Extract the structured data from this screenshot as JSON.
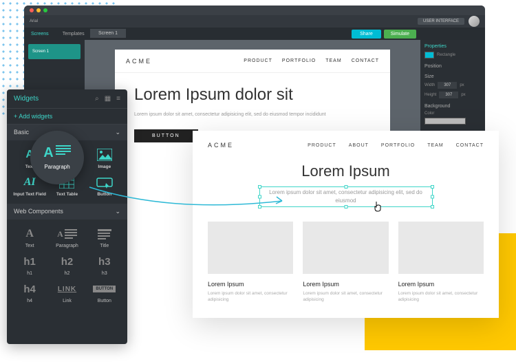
{
  "toolbar": {
    "arial": "Arial",
    "user_menu": "USER INTERFACE"
  },
  "subbar": {
    "screens": "Screens",
    "templates": "Templates",
    "share": "Share",
    "simulate": "Simulate",
    "tab": "Screen 1"
  },
  "screens": {
    "item1": "Screen 1"
  },
  "canvas": {
    "brand": "ACME",
    "nav": [
      "PRODUCT",
      "PORTFOLIO",
      "TEAM",
      "CONTACT"
    ],
    "headline": "Lorem Ipsum dolor sit",
    "body": "Lorem ipsum dolor sit amet, consectetur adipisicing elit, sed do eiusmod tempor incididunt",
    "button": "BUTTON"
  },
  "properties": {
    "title": "Properties",
    "shape": "Rectangle",
    "position": "Position",
    "size": "Size",
    "width": "Width",
    "height": "Height",
    "val_width": "307",
    "val_height": "307",
    "px": "px",
    "background": "Background",
    "color": "Color"
  },
  "widgets": {
    "title": "Widgets",
    "add": "+ Add widgets",
    "basic": "Basic",
    "items_basic": {
      "text": "Text",
      "paragraph": "Paragraph",
      "image": "Image",
      "input": "Input Text Field",
      "table": "Text Table",
      "button": "Button"
    },
    "webcomp": "Web Components",
    "items_wc": {
      "text": "Text",
      "paragraph": "Paragraph",
      "title": "Title",
      "h1": "h1",
      "h2": "h2",
      "h3": "h3",
      "h4": "h4",
      "link": "Link",
      "button": "Button"
    }
  },
  "bubble": {
    "label": "Paragraph"
  },
  "preview": {
    "brand": "ACME",
    "nav": [
      "PRODUCT",
      "ABOUT",
      "PORTFOLIO",
      "TEAM",
      "CONTACT"
    ],
    "title": "Lorem Ipsum",
    "selected": "Lorem ipsum dolor sit amet, consectetur adipisicing elit, sed do eiusmod",
    "cards": [
      {
        "title": "Lorem Ipsum",
        "text": "Lorem ipsum dolor sit amet, consectetur adipisicing"
      },
      {
        "title": "Lorem Ipsum",
        "text": "Lorem ipsum dolor sit amet, consectetur adipisicing"
      },
      {
        "title": "Lorem Ipsum",
        "text": "Lorem ipsum dolor sit amet, consectetur adipisicing"
      }
    ]
  }
}
